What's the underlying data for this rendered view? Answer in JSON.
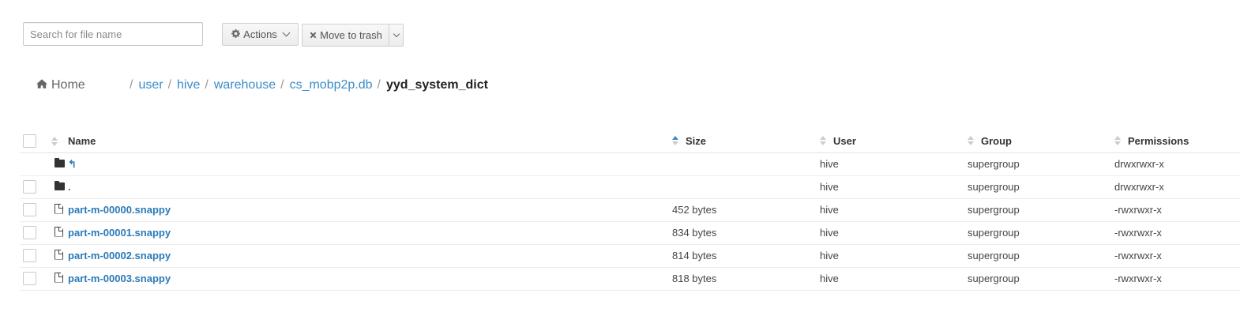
{
  "search": {
    "placeholder": "Search for file name"
  },
  "toolbar": {
    "actions_label": "Actions",
    "trash_label": "Move to trash"
  },
  "breadcrumb": {
    "home_label": "Home",
    "path": [
      "user",
      "hive",
      "warehouse",
      "cs_mobp2p.db"
    ],
    "current": "yyd_system_dict"
  },
  "table": {
    "headers": {
      "name": "Name",
      "size": "Size",
      "user": "User",
      "group": "Group",
      "permissions": "Permissions"
    },
    "sorted_column": "size",
    "rows": [
      {
        "type": "folder",
        "name": "↰",
        "size": "",
        "user": "hive",
        "group": "supergroup",
        "permissions": "drwxrwxr-x"
      },
      {
        "type": "folder",
        "name": ".",
        "size": "",
        "user": "hive",
        "group": "supergroup",
        "permissions": "drwxrwxr-x"
      },
      {
        "type": "file",
        "name": "part-m-00000.snappy",
        "size": "452 bytes",
        "user": "hive",
        "group": "supergroup",
        "permissions": "-rwxrwxr-x"
      },
      {
        "type": "file",
        "name": "part-m-00001.snappy",
        "size": "834 bytes",
        "user": "hive",
        "group": "supergroup",
        "permissions": "-rwxrwxr-x"
      },
      {
        "type": "file",
        "name": "part-m-00002.snappy",
        "size": "814 bytes",
        "user": "hive",
        "group": "supergroup",
        "permissions": "-rwxrwxr-x"
      },
      {
        "type": "file",
        "name": "part-m-00003.snappy",
        "size": "818 bytes",
        "user": "hive",
        "group": "supergroup",
        "permissions": "-rwxrwxr-x"
      }
    ]
  },
  "colors": {
    "link": "#2a7ab8",
    "sort_active": "#3a8cc7"
  },
  "icons": [
    "gear-icon",
    "close-icon",
    "chevron-down-icon",
    "home-icon",
    "folder-icon",
    "file-icon",
    "sort-icon",
    "up-arrow-icon"
  ]
}
